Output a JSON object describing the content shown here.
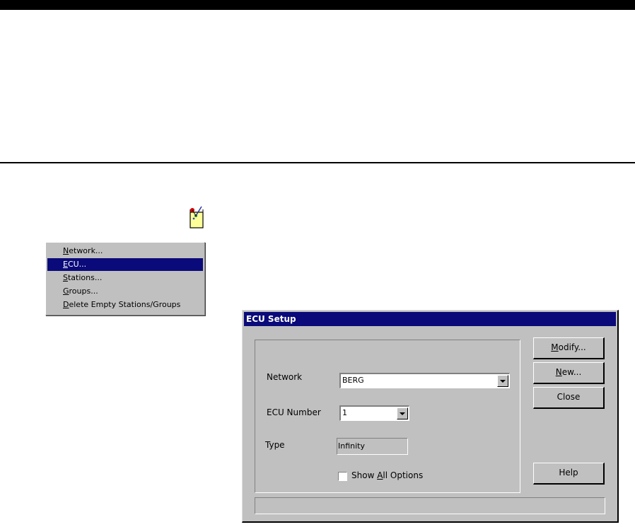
{
  "menu": {
    "items": [
      {
        "pre": "",
        "key": "N",
        "post": "etwork...",
        "selected": false
      },
      {
        "pre": "",
        "key": "E",
        "post": "CU...",
        "selected": true
      },
      {
        "pre": "",
        "key": "S",
        "post": "tations...",
        "selected": false
      },
      {
        "pre": "",
        "key": "G",
        "post": "roups...",
        "selected": false
      },
      {
        "pre": "",
        "key": "D",
        "post": "elete Empty Stations/Groups",
        "selected": false
      }
    ]
  },
  "dialog": {
    "title": "ECU Setup",
    "network_label": "Network",
    "network_value": "BERG",
    "ecu_number_label": "ECU Number",
    "ecu_number_value": "1",
    "type_label": "Type",
    "type_value": "Infinity",
    "show_all": {
      "pre": "Show ",
      "key": "A",
      "post": "ll Options",
      "checked": false
    },
    "buttons": {
      "modify": {
        "key": "M",
        "post": "odify..."
      },
      "new": {
        "key": "N",
        "post": "ew..."
      },
      "close": "Close",
      "help": "Help"
    },
    "status_text": ""
  },
  "colors": {
    "selection": "#0a0a7a",
    "titlebar": "#0a0a7a",
    "face": "#c0c0c0"
  }
}
